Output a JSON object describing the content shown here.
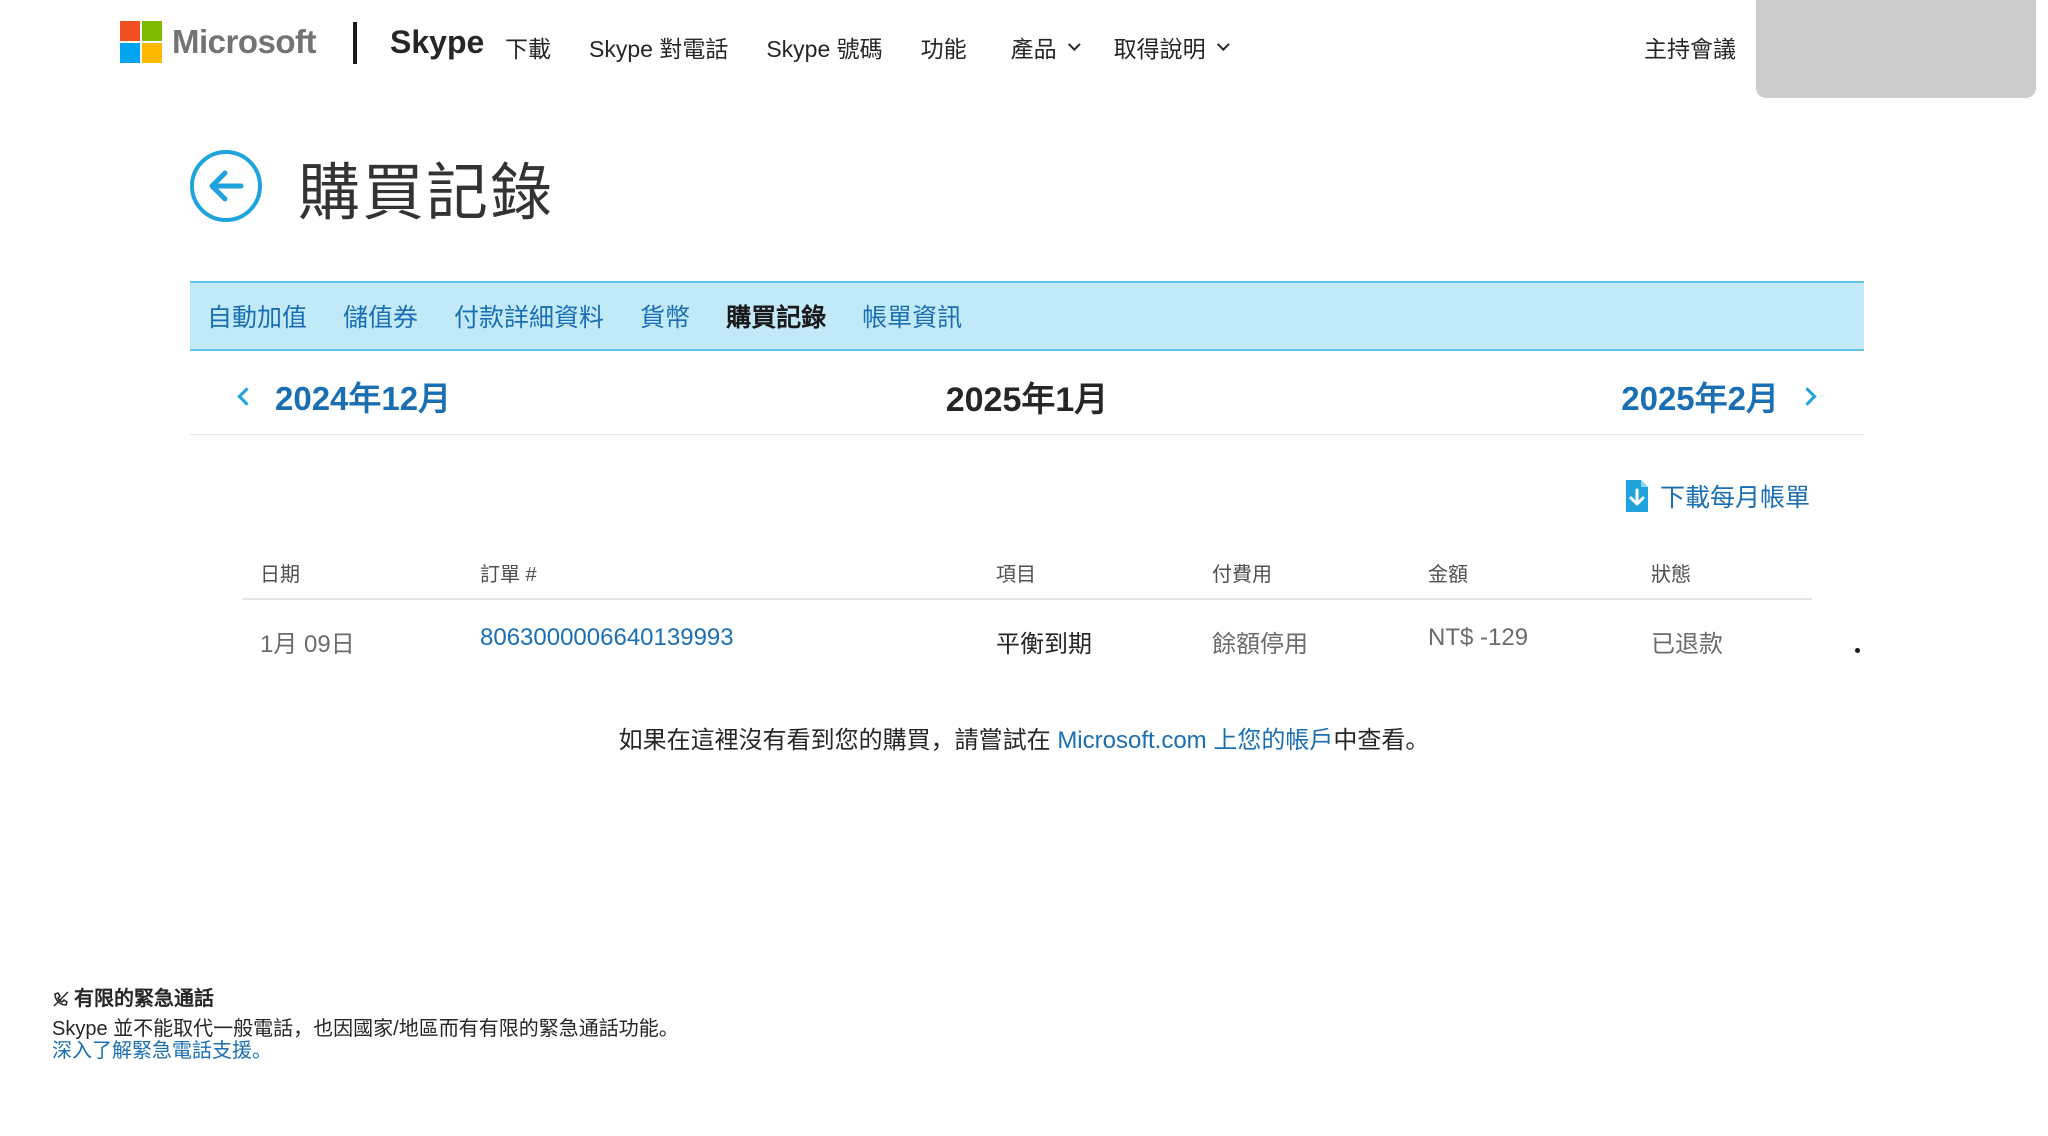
{
  "header": {
    "brand": "Microsoft",
    "product": "Skype",
    "nav": [
      {
        "label": "下載"
      },
      {
        "label": "Skype 對電話"
      },
      {
        "label": "Skype 號碼"
      },
      {
        "label": "功能"
      },
      {
        "label": "產品"
      },
      {
        "label": "取得說明"
      }
    ],
    "host_meeting": "主持會議",
    "logo_colors": [
      "#f25022",
      "#7fba00",
      "#00a4ef",
      "#ffb900"
    ]
  },
  "page": {
    "title": "購買記錄",
    "back_icon": "arrow-left-circle-icon"
  },
  "tabs": [
    {
      "label": "自動加值",
      "active": false
    },
    {
      "label": "儲值券",
      "active": false
    },
    {
      "label": "付款詳細資料",
      "active": false
    },
    {
      "label": "貨幣",
      "active": false
    },
    {
      "label": "購買記錄",
      "active": true
    },
    {
      "label": "帳單資訊",
      "active": false
    }
  ],
  "month_nav": {
    "prev": "2024年12月",
    "current": "2025年1月",
    "next": "2025年2月"
  },
  "download": {
    "label": "下載每月帳單",
    "icon": "download-document-icon"
  },
  "table": {
    "headers": {
      "date": "日期",
      "order": "訂單 #",
      "item": "項目",
      "payment": "付費用",
      "amount": "金額",
      "status": "狀態"
    },
    "rows": [
      {
        "date": "1月 09日",
        "order": "8063000006640139993",
        "item": "平衡到期",
        "payment": "餘額停用",
        "amount": "NT$ -129",
        "status": "已退款"
      }
    ]
  },
  "notice": {
    "before": "如果在這裡沒有看到您的購買，請嘗試在 ",
    "link": "Microsoft.com 上您的帳戶",
    "after": "中查看。"
  },
  "footer": {
    "heading": "有限的緊急通話",
    "text": "Skype 並不能取代一般電話，也因國家/地區而有有限的緊急通話功能。",
    "link": "深入了解緊急電話支援。"
  },
  "colors": {
    "accent": "#1fa3dc",
    "link": "#1a6fb3",
    "tab_bg": "#c2e9f8"
  }
}
